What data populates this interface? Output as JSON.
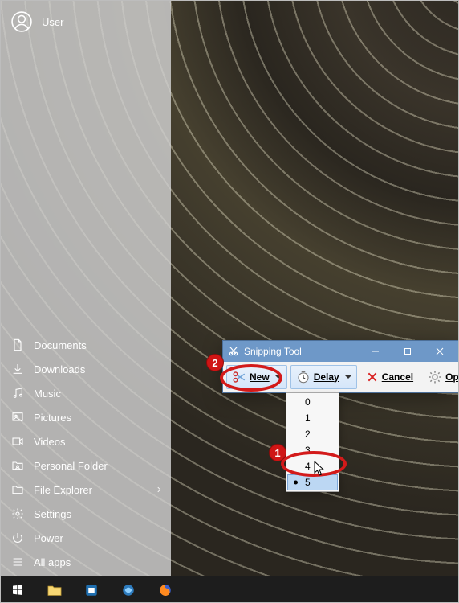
{
  "start_menu": {
    "user": "User",
    "items": [
      {
        "key": "documents",
        "label": "Documents"
      },
      {
        "key": "downloads",
        "label": "Downloads"
      },
      {
        "key": "music",
        "label": "Music"
      },
      {
        "key": "pictures",
        "label": "Pictures"
      },
      {
        "key": "videos",
        "label": "Videos"
      },
      {
        "key": "personal",
        "label": "Personal Folder"
      },
      {
        "key": "explorer",
        "label": "File Explorer",
        "chevron": true
      },
      {
        "key": "settings",
        "label": "Settings"
      },
      {
        "key": "power",
        "label": "Power"
      },
      {
        "key": "allapps",
        "label": "All apps"
      }
    ]
  },
  "snipping_tool": {
    "title": "Snipping Tool",
    "buttons": {
      "new": "New",
      "delay": "Delay",
      "cancel": "Cancel",
      "options": "Options"
    },
    "delay_menu": {
      "options": [
        "0",
        "1",
        "2",
        "3",
        "4",
        "5"
      ],
      "selected": "5"
    }
  },
  "annotations": {
    "bubble1": "1",
    "bubble2": "2"
  },
  "colors": {
    "titlebar": "#6e98c8",
    "annotation_red": "#d31a1a"
  }
}
